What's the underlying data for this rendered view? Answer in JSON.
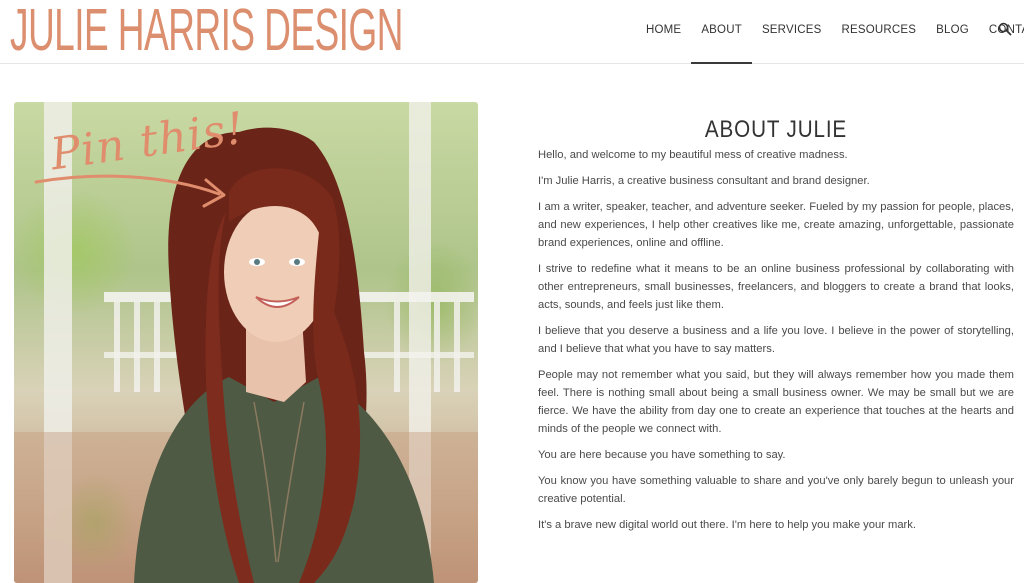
{
  "header": {
    "logo": "JULIE HARRIS DESIGN",
    "nav": [
      {
        "label": "HOME"
      },
      {
        "label": "ABOUT"
      },
      {
        "label": "SERVICES"
      },
      {
        "label": "RESOURCES"
      },
      {
        "label": "BLOG"
      },
      {
        "label": "CONTACT"
      }
    ],
    "active_nav": "ABOUT",
    "search_icon": "search-icon"
  },
  "photo": {
    "overlay_text": "Pin this!",
    "arrow_icon": "arrow-right-icon"
  },
  "main": {
    "title": "ABOUT JULIE",
    "paragraphs": [
      "Hello, and welcome to my beautiful mess of creative madness.",
      "I'm Julie Harris, a creative business consultant and brand designer.",
      "I am a writer, speaker, teacher, and adventure seeker. Fueled by my passion for people, places, and new experiences, I help other creatives like me, create amazing, unforgettable, passionate brand experiences, online and offline.",
      "I strive to redefine what it means to be an online business professional by collaborating with other entrepreneurs, small businesses, freelancers, and bloggers to create a brand that looks, acts, sounds, and feels just like them.",
      "I believe that you deserve a business and a life you love. I believe in the power of storytelling, and I believe that what you have to say matters.",
      "People may not remember what you said, but they will always remember how you made them feel. There is nothing small about being a small business owner. We may be small but we are fierce. We have the ability from day one to create an experience that touches at the hearts and minds of the people we connect with.",
      "You are here because you have something to say.",
      "You know you have something valuable to share and you've only barely begun to unleash your creative potential.",
      "It's a brave new digital world out there. I'm here to help you make your mark."
    ]
  },
  "colors": {
    "brand": "#dc8f6f",
    "text": "#4a4a4a",
    "nav_text": "#333333"
  }
}
